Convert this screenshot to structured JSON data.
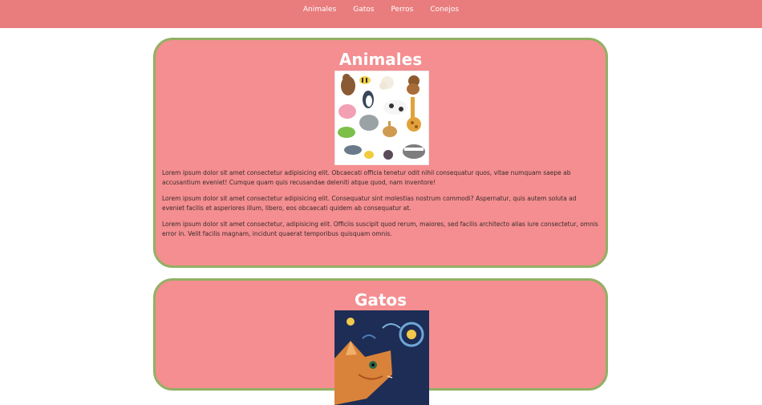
{
  "nav": {
    "links": [
      "Animales",
      "Gatos",
      "Perros",
      "Conejos"
    ]
  },
  "sections": [
    {
      "title": "Animales",
      "paragraphs": [
        "Lorem ipsum dolor sit amet consectetur adipisicing elit. Obcaecati officia tenetur odit nihil consequatur quos, vitae numquam saepe ab accusantium eveniet! Cumque quam quis recusandae deleniti atque quod, nam inventore!",
        "Lorem ipsum dolor sit amet consectetur adipisicing elit. Consequatur sint molestias nostrum commodi? Aspernatur, quis autem soluta ad eveniet facilis et asperiores illum, libero, eos obcaecati quidem ab consequatur at.",
        "Lorem ipsum dolor sit amet consectetur, adipisicing elit. Officiis suscipit quod rerum, maiores, sed facilis architecto alias iure consectetur, omnis error in. Velit facilis magnam, incidunt quaerat temporibus quisquam omnis."
      ]
    },
    {
      "title": "Gatos"
    }
  ]
}
